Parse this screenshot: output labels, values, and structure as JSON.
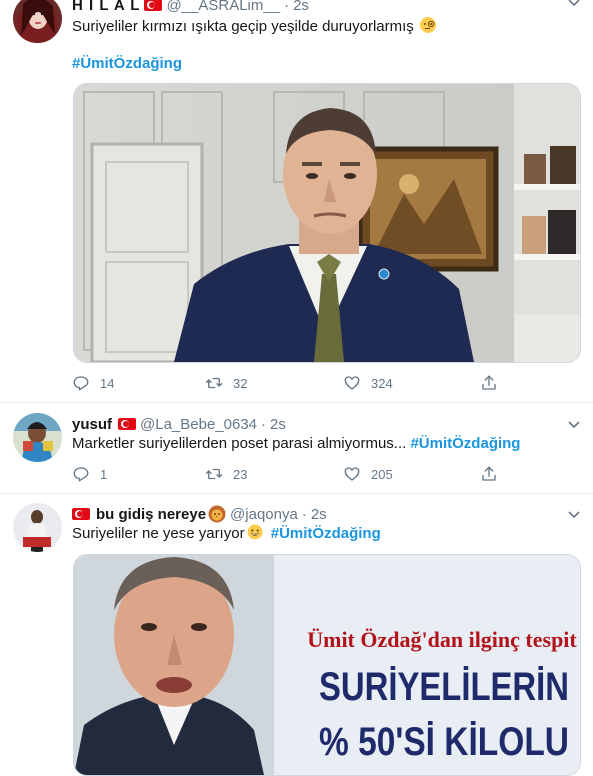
{
  "colors": {
    "accent": "#1b95e0",
    "secondary_text": "#657786",
    "divider": "#e6ecf0",
    "flag": "#e30a17"
  },
  "tweets": [
    {
      "display_name": "H I L A L",
      "handle": "@__ASRALim__",
      "dot": "·",
      "time": "2s",
      "text": "Suriyeliler kırmızı ışıkta geçip yeşilde duruyorlarmış",
      "emoji": "face-with-monocle",
      "hashtag": "#ÜmitÖzdağing",
      "replies": "14",
      "retweets": "32",
      "likes": "324"
    },
    {
      "display_name": "yusuf",
      "handle": "@La_Bebe_0634",
      "dot": "·",
      "time": "2s",
      "text": "Marketler suriyelilerden poset parasi almiyormus...",
      "hashtag": "#ÜmitÖzdağing",
      "replies": "1",
      "retweets": "23",
      "likes": "205"
    },
    {
      "display_name": "bu gidiş nereye",
      "emoji_after_name": "lion-face",
      "handle": "@jaqonya",
      "dot": "·",
      "time": "2s",
      "text": "Suriyeliler ne yese yarıyor",
      "emoji": "grinning-face",
      "hashtag": "#ÜmitÖzdağing",
      "image_headline": "Ümit Özdağ'dan ilginç tespit",
      "image_big_line1": "SURİYELİLERİN",
      "image_big_line2": "% 50'Sİ KİLOLU"
    }
  ],
  "icons": {
    "reply": "reply-icon",
    "retweet": "retweet-icon",
    "like": "heart-icon",
    "share": "share-icon",
    "more": "chevron-down-icon"
  }
}
